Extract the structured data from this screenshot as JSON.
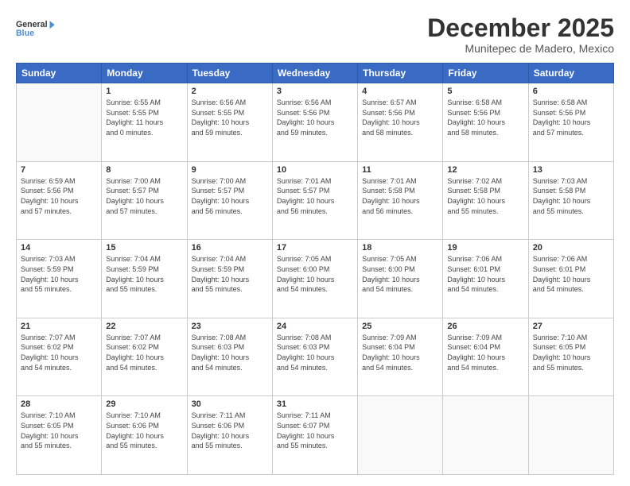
{
  "header": {
    "logo": {
      "general": "General",
      "blue": "Blue"
    },
    "title": "December 2025",
    "location": "Munitepec de Madero, Mexico"
  },
  "weekdays": [
    "Sunday",
    "Monday",
    "Tuesday",
    "Wednesday",
    "Thursday",
    "Friday",
    "Saturday"
  ],
  "weeks": [
    [
      {
        "day": "",
        "info": ""
      },
      {
        "day": "1",
        "info": "Sunrise: 6:55 AM\nSunset: 5:55 PM\nDaylight: 11 hours\nand 0 minutes."
      },
      {
        "day": "2",
        "info": "Sunrise: 6:56 AM\nSunset: 5:55 PM\nDaylight: 10 hours\nand 59 minutes."
      },
      {
        "day": "3",
        "info": "Sunrise: 6:56 AM\nSunset: 5:56 PM\nDaylight: 10 hours\nand 59 minutes."
      },
      {
        "day": "4",
        "info": "Sunrise: 6:57 AM\nSunset: 5:56 PM\nDaylight: 10 hours\nand 58 minutes."
      },
      {
        "day": "5",
        "info": "Sunrise: 6:58 AM\nSunset: 5:56 PM\nDaylight: 10 hours\nand 58 minutes."
      },
      {
        "day": "6",
        "info": "Sunrise: 6:58 AM\nSunset: 5:56 PM\nDaylight: 10 hours\nand 57 minutes."
      }
    ],
    [
      {
        "day": "7",
        "info": "Sunrise: 6:59 AM\nSunset: 5:56 PM\nDaylight: 10 hours\nand 57 minutes."
      },
      {
        "day": "8",
        "info": "Sunrise: 7:00 AM\nSunset: 5:57 PM\nDaylight: 10 hours\nand 57 minutes."
      },
      {
        "day": "9",
        "info": "Sunrise: 7:00 AM\nSunset: 5:57 PM\nDaylight: 10 hours\nand 56 minutes."
      },
      {
        "day": "10",
        "info": "Sunrise: 7:01 AM\nSunset: 5:57 PM\nDaylight: 10 hours\nand 56 minutes."
      },
      {
        "day": "11",
        "info": "Sunrise: 7:01 AM\nSunset: 5:58 PM\nDaylight: 10 hours\nand 56 minutes."
      },
      {
        "day": "12",
        "info": "Sunrise: 7:02 AM\nSunset: 5:58 PM\nDaylight: 10 hours\nand 55 minutes."
      },
      {
        "day": "13",
        "info": "Sunrise: 7:03 AM\nSunset: 5:58 PM\nDaylight: 10 hours\nand 55 minutes."
      }
    ],
    [
      {
        "day": "14",
        "info": "Sunrise: 7:03 AM\nSunset: 5:59 PM\nDaylight: 10 hours\nand 55 minutes."
      },
      {
        "day": "15",
        "info": "Sunrise: 7:04 AM\nSunset: 5:59 PM\nDaylight: 10 hours\nand 55 minutes."
      },
      {
        "day": "16",
        "info": "Sunrise: 7:04 AM\nSunset: 5:59 PM\nDaylight: 10 hours\nand 55 minutes."
      },
      {
        "day": "17",
        "info": "Sunrise: 7:05 AM\nSunset: 6:00 PM\nDaylight: 10 hours\nand 54 minutes."
      },
      {
        "day": "18",
        "info": "Sunrise: 7:05 AM\nSunset: 6:00 PM\nDaylight: 10 hours\nand 54 minutes."
      },
      {
        "day": "19",
        "info": "Sunrise: 7:06 AM\nSunset: 6:01 PM\nDaylight: 10 hours\nand 54 minutes."
      },
      {
        "day": "20",
        "info": "Sunrise: 7:06 AM\nSunset: 6:01 PM\nDaylight: 10 hours\nand 54 minutes."
      }
    ],
    [
      {
        "day": "21",
        "info": "Sunrise: 7:07 AM\nSunset: 6:02 PM\nDaylight: 10 hours\nand 54 minutes."
      },
      {
        "day": "22",
        "info": "Sunrise: 7:07 AM\nSunset: 6:02 PM\nDaylight: 10 hours\nand 54 minutes."
      },
      {
        "day": "23",
        "info": "Sunrise: 7:08 AM\nSunset: 6:03 PM\nDaylight: 10 hours\nand 54 minutes."
      },
      {
        "day": "24",
        "info": "Sunrise: 7:08 AM\nSunset: 6:03 PM\nDaylight: 10 hours\nand 54 minutes."
      },
      {
        "day": "25",
        "info": "Sunrise: 7:09 AM\nSunset: 6:04 PM\nDaylight: 10 hours\nand 54 minutes."
      },
      {
        "day": "26",
        "info": "Sunrise: 7:09 AM\nSunset: 6:04 PM\nDaylight: 10 hours\nand 54 minutes."
      },
      {
        "day": "27",
        "info": "Sunrise: 7:10 AM\nSunset: 6:05 PM\nDaylight: 10 hours\nand 55 minutes."
      }
    ],
    [
      {
        "day": "28",
        "info": "Sunrise: 7:10 AM\nSunset: 6:05 PM\nDaylight: 10 hours\nand 55 minutes."
      },
      {
        "day": "29",
        "info": "Sunrise: 7:10 AM\nSunset: 6:06 PM\nDaylight: 10 hours\nand 55 minutes."
      },
      {
        "day": "30",
        "info": "Sunrise: 7:11 AM\nSunset: 6:06 PM\nDaylight: 10 hours\nand 55 minutes."
      },
      {
        "day": "31",
        "info": "Sunrise: 7:11 AM\nSunset: 6:07 PM\nDaylight: 10 hours\nand 55 minutes."
      },
      {
        "day": "",
        "info": ""
      },
      {
        "day": "",
        "info": ""
      },
      {
        "day": "",
        "info": ""
      }
    ]
  ]
}
